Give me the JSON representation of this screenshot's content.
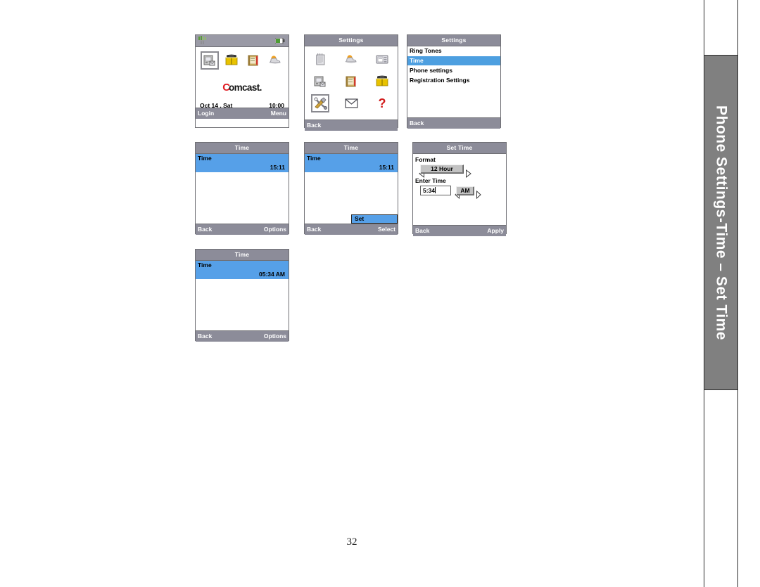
{
  "page": {
    "number": "32",
    "side_tab_label": "Phone Settings-Time – Set Time"
  },
  "screens": {
    "home": {
      "icons": [
        {
          "name": "device-settings-icon",
          "selected": true
        },
        {
          "name": "address-book-icon",
          "selected": false
        },
        {
          "name": "notes-book-icon",
          "selected": false
        },
        {
          "name": "weather-cloud-icon",
          "selected": false
        }
      ],
      "brand_c": "C",
      "brand_text": "omcast.",
      "date": "Oct 14 , Sat",
      "time": "10:00",
      "softkey_left": "Login",
      "softkey_right": "Menu",
      "status_signal_icon": "signal-bars-icon",
      "status_battery_icon": "battery-icon"
    },
    "settings_grid": {
      "title": "Settings",
      "icons": [
        {
          "name": "notepad-icon",
          "selected": false
        },
        {
          "name": "weather-cloud-icon",
          "selected": false
        },
        {
          "name": "calculator-icon",
          "selected": false
        },
        {
          "name": "voicemail-icon",
          "selected": false
        },
        {
          "name": "notes-book-icon",
          "selected": false
        },
        {
          "name": "address-book-icon",
          "selected": false
        },
        {
          "name": "tools-icon",
          "selected": true
        },
        {
          "name": "envelope-icon",
          "selected": false
        },
        {
          "name": "help-question-icon",
          "selected": false
        }
      ],
      "softkey_left": "Back",
      "softkey_right": ""
    },
    "settings_list": {
      "title": "Settings",
      "items": [
        {
          "label": "Ring Tones",
          "selected": false
        },
        {
          "label": "Time",
          "selected": true
        },
        {
          "label": "Phone settings",
          "selected": false
        },
        {
          "label": "Registration Settings",
          "selected": false
        }
      ],
      "softkey_left": "Back",
      "softkey_right": ""
    },
    "time_options": {
      "title": "Time",
      "row_label": "Time",
      "row_value": "15:11",
      "softkey_left": "Back",
      "softkey_right": "Options"
    },
    "time_popup": {
      "title": "Time",
      "row_label": "Time",
      "row_value": "15:11",
      "popup_label": "Set",
      "softkey_left": "Back",
      "softkey_right": "Select"
    },
    "set_time": {
      "title": "Set Time",
      "format_label": "Format",
      "format_value": "12 Hour",
      "enter_time_label": "Enter Time",
      "time_value": "5:34",
      "ampm_value": "AM",
      "softkey_left": "Back",
      "softkey_right": "Apply"
    },
    "time_result": {
      "title": "Time",
      "row_label": "Time",
      "row_value": "05:34 AM",
      "softkey_left": "Back",
      "softkey_right": "Options"
    }
  },
  "colors": {
    "titlebar": "#8c8c99",
    "highlight": "#56a0e8",
    "list_highlight": "#4d9fe0",
    "side_tab": "#808080",
    "brand_red": "#e11b22"
  }
}
